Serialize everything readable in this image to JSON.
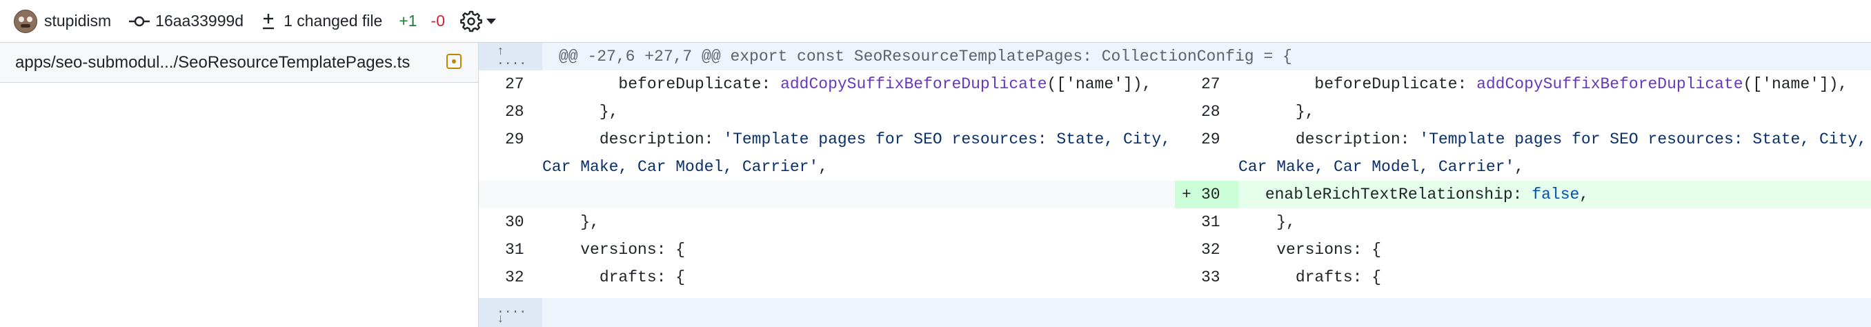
{
  "header": {
    "user": "stupidism",
    "commit": "16aa33999d",
    "changed_files": "1 changed file",
    "additions": "+1",
    "deletions": "-0"
  },
  "sidebar": {
    "file_path": "apps/seo-submodul.../SeoResourceTemplatePages.ts"
  },
  "diff": {
    "hunk_header": "@@ -27,6 +27,7 @@ export const SeoResourceTemplatePages: CollectionConfig = {",
    "rows": [
      {
        "left_num": "27",
        "right_num": "27",
        "prefix": "        beforeDuplicate: ",
        "fn": "addCopySuffixBeforeDuplicate",
        "args": "(['name']),"
      },
      {
        "left_num": "28",
        "right_num": "28",
        "text": "      },"
      },
      {
        "left_num": "29",
        "right_num": "29",
        "prefix": "      description: ",
        "str": "'Template pages for SEO resources: State, City, Car Make, Car Model, Carrier'",
        "suffix": ","
      },
      {
        "left_num": "",
        "right_num": "30",
        "marker": "+",
        "prefix": "      enableRichTextRelationship: ",
        "kw": "false",
        "suffix": ","
      },
      {
        "left_num": "30",
        "right_num": "31",
        "text": "    },"
      },
      {
        "left_num": "31",
        "right_num": "32",
        "text": "    versions: {"
      },
      {
        "left_num": "32",
        "right_num": "33",
        "text": "      drafts: {"
      }
    ]
  },
  "colors": {
    "addition": "#1a7f37",
    "deletion": "#d1242f",
    "function": "#6639ba",
    "string": "#0a3069",
    "keyword": "#0550ae",
    "added_line_bg": "#e6ffec"
  },
  "icons": {
    "commit": "git-commit-icon",
    "diff": "diff-icon",
    "settings": "gear-icon",
    "dropdown": "triangle-down-icon",
    "expand_up": "expand-up-icon",
    "expand_down": "expand-down-icon"
  }
}
